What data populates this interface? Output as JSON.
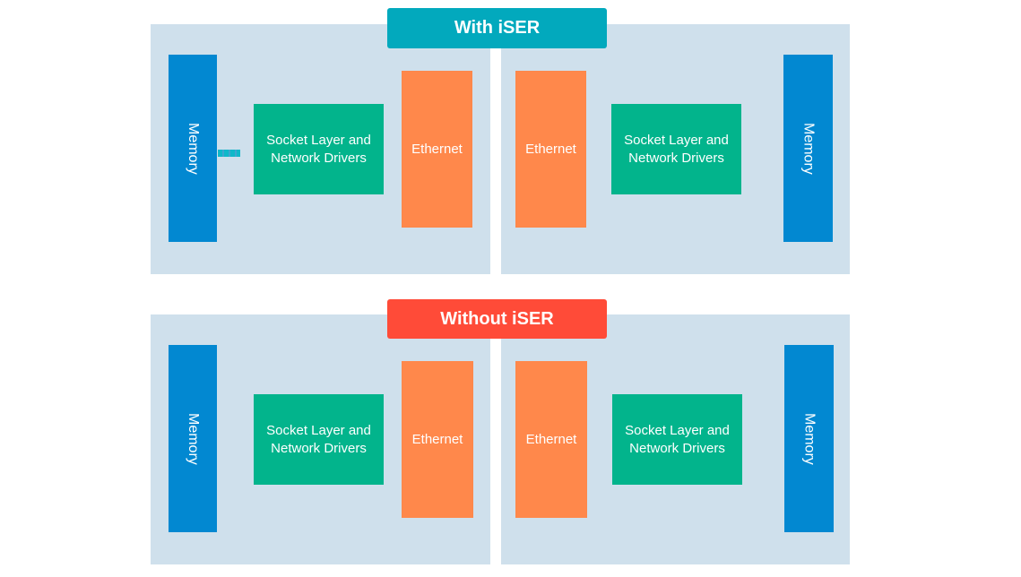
{
  "colors": {
    "panel": "#cfe0ec",
    "memory": "#0288d1",
    "socket": "#02b48c",
    "ethernet": "#ff884b",
    "with_title": "#02a9bd",
    "without_title": "#ff4b38"
  },
  "sections": [
    {
      "title": "With iSER",
      "memory": "Memory",
      "socket_line1": "Socket Layer and",
      "socket_line2": "Network Drivers",
      "ethernet": "Ethernet"
    },
    {
      "title": "Without iSER",
      "memory": "Memory",
      "socket_line1": "Socket Layer and",
      "socket_line2": "Network Drivers",
      "ethernet": "Ethernet"
    }
  ]
}
